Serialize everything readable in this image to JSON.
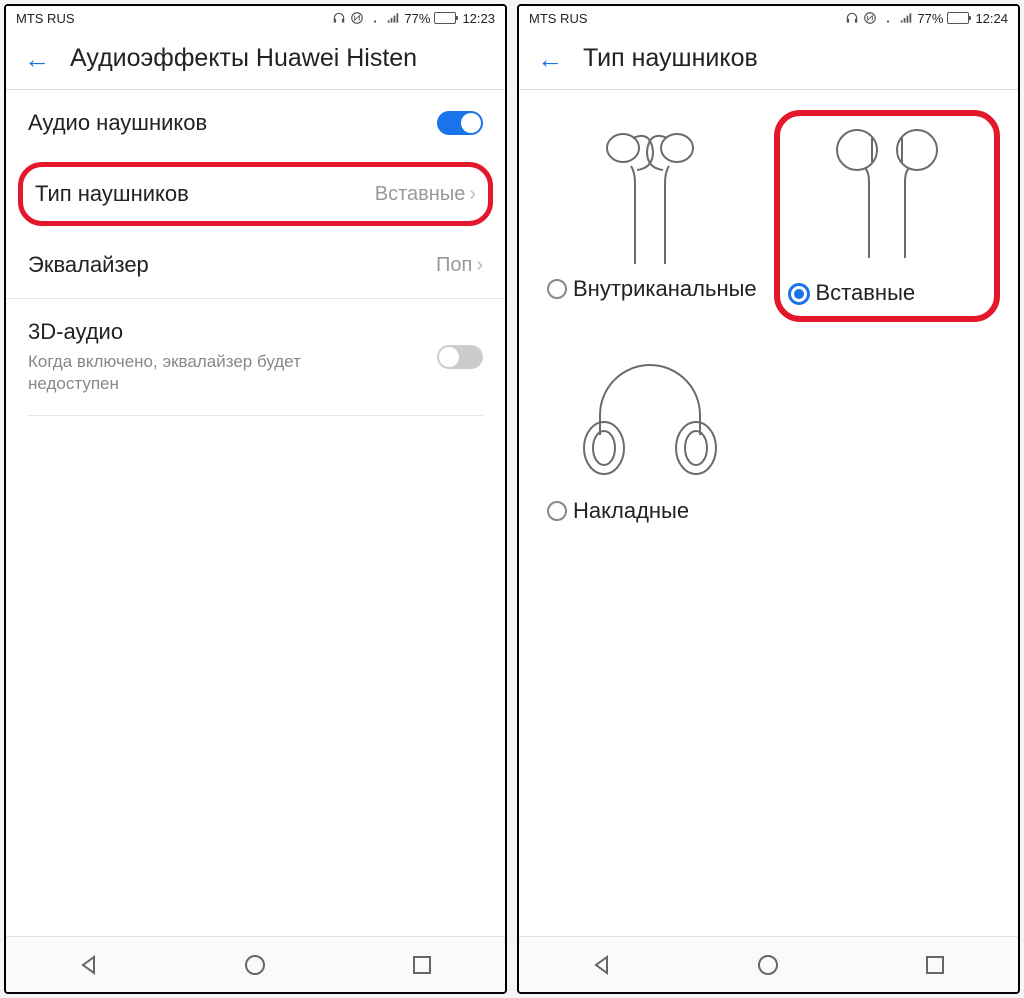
{
  "left": {
    "statusbar": {
      "carrier": "MTS RUS",
      "battery_pct": "77%",
      "time": "12:23"
    },
    "header": {
      "title": "Аудиоэффекты Huawei Histen"
    },
    "rows": {
      "audio_headphones": {
        "label": "Аудио наушников"
      },
      "headphone_type": {
        "label": "Тип наушников",
        "value": "Вставные"
      },
      "equalizer": {
        "label": "Эквалайзер",
        "value": "Поп"
      },
      "audio3d": {
        "label": "3D-аудио",
        "desc": "Когда включено, эквалайзер будет недоступен"
      }
    }
  },
  "right": {
    "statusbar": {
      "carrier": "MTS RUS",
      "battery_pct": "77%",
      "time": "12:24"
    },
    "header": {
      "title": "Тип наушников"
    },
    "options": {
      "in_ear": {
        "label": "Внутриканальные"
      },
      "earbuds": {
        "label": "Вставные"
      },
      "on_ear": {
        "label": "Накладные"
      }
    }
  }
}
